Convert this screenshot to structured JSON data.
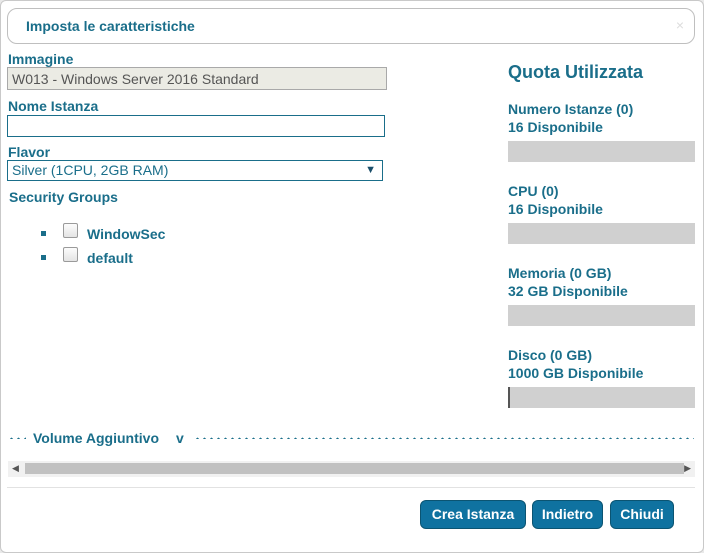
{
  "dialog": {
    "title": "Imposta le caratteristiche",
    "close_glyph": "×"
  },
  "form": {
    "image_label": "Immagine",
    "image_value": "W013 - Windows Server 2016 Standard",
    "name_label": "Nome Istanza",
    "name_value": "",
    "flavor_label": "Flavor",
    "flavor_value": "Silver (1CPU, 2GB RAM)",
    "flavor_arrow": "▼",
    "sg_label": "Security Groups",
    "security_groups": [
      {
        "name": "WindowSec",
        "checked": false
      },
      {
        "name": "default",
        "checked": false
      }
    ]
  },
  "quota": {
    "title": "Quota Utilizzata",
    "items": [
      {
        "label": "Numero Istanze (0)",
        "available": "16 Disponibile",
        "used_fraction": 0
      },
      {
        "label": "CPU (0)",
        "available": "16 Disponibile",
        "used_fraction": 0
      },
      {
        "label": "Memoria (0 GB)",
        "available": "32 GB Disponibile",
        "used_fraction": 0
      },
      {
        "label": "Disco (0 GB)",
        "available": "1000 GB Disponibile",
        "used_fraction": 0.01
      }
    ]
  },
  "volume": {
    "label": "Volume Aggiuntivo",
    "chevron": "v"
  },
  "scrollbar": {
    "left_arrow": "◀",
    "right_arrow": "▶"
  },
  "buttons": {
    "create": "Crea Istanza",
    "back": "Indietro",
    "close": "Chiudi"
  },
  "colors": {
    "accent": "#1a6e8a",
    "button_bg": "#0f72a0",
    "bar_bg": "#d0d0d0"
  }
}
